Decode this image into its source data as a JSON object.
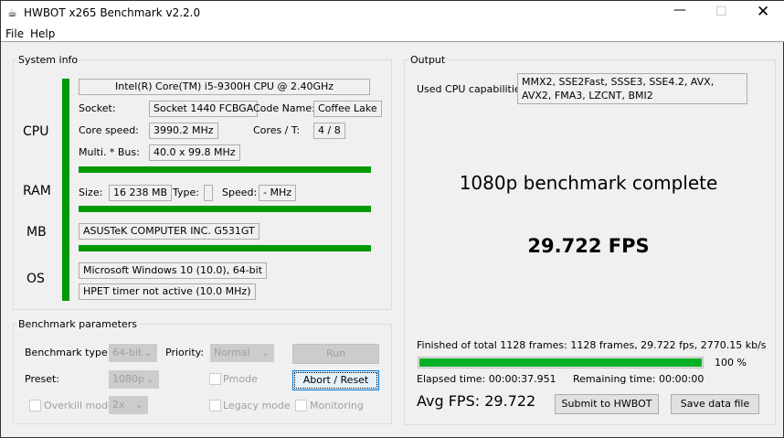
{
  "window": {
    "title": "HWBOT x265 Benchmark v2.2.0",
    "icon": "app-icon"
  },
  "menu": [
    "File",
    "Help"
  ],
  "system_info": {
    "label": "System info",
    "cpu": {
      "label": "CPU",
      "name": "Intel(R) Core(TM) i5-9300H CPU @ 2.40GHz",
      "socket_label": "Socket:",
      "socket": "Socket 1440 FCBGA",
      "code_name_label": "Code Name:",
      "code_name": "Coffee Lake",
      "core_speed_label": "Core speed:",
      "core_speed": "3990.2 MHz",
      "cores_label": "Cores / T:",
      "cores": "4 / 8",
      "multi_label": "Multi. * Bus:",
      "multi": "40.0 x 99.8 MHz"
    },
    "ram": {
      "label": "RAM",
      "size_label": "Size:",
      "size": "16 238 MB",
      "type_label": "Type:",
      "type": "",
      "speed_label": "Speed:",
      "speed": "- MHz"
    },
    "mb": {
      "label": "MB",
      "name": "ASUSTeK COMPUTER INC. G531GT"
    },
    "os": {
      "label": "OS",
      "name": "Microsoft Windows 10 (10.0), 64-bit",
      "timer": "HPET timer not active (10.0 MHz)"
    }
  },
  "params": {
    "label": "Benchmark parameters",
    "type_label": "Benchmark type:",
    "type": "64-bit",
    "priority_label": "Priority:",
    "priority": "Normal",
    "run": "Run",
    "preset_label": "Preset:",
    "preset": "1080p",
    "pmode": "Pmode",
    "pmode_checked": false,
    "abort": "Abort / Reset",
    "overkill": "Overkill mode",
    "overkill_checked": false,
    "overkill_value": "2x",
    "legacy": "Legacy mode",
    "legacy_checked": false,
    "monitoring": "Monitoring",
    "monitoring_checked": false
  },
  "output": {
    "label": "Output",
    "caps_label": "Used CPU capabilities:",
    "caps": "MMX2, SSE2Fast, SSSE3, SSE4.2, AVX, AVX2, FMA3, LZCNT, BMI2",
    "status": "1080p benchmark complete",
    "fps": "29.722 FPS",
    "finished": "Finished of total 1128 frames: 1128 frames, 29.722 fps,  2770.15 kb/s",
    "progress": 100,
    "progress_text": "100 %",
    "elapsed": "Elapsed time: 00:00:37.951",
    "remaining": "Remaining time: 00:00:00",
    "avg": "Avg FPS: 29.722",
    "submit": "Submit to HWBOT",
    "save": "Save data file"
  },
  "colors": {
    "accent_green": "#009900",
    "progress_green": "#06b025",
    "focus_blue": "#0078d7"
  }
}
